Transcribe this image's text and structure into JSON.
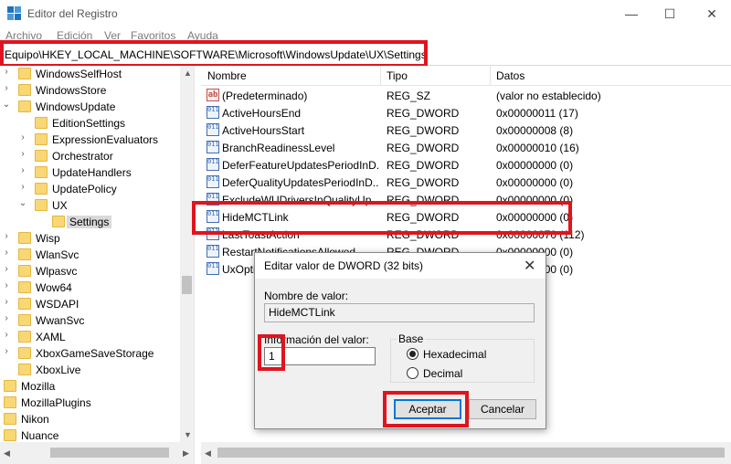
{
  "window": {
    "title": "Editor del Registro",
    "minimize": "—",
    "maximize": "☐",
    "close": "✕"
  },
  "menu": [
    "Archivo",
    "Edición",
    "Ver",
    "Favoritos",
    "Ayuda"
  ],
  "address": "Equipo\\HKEY_LOCAL_MACHINE\\SOFTWARE\\Microsoft\\WindowsUpdate\\UX\\Settings",
  "tree": [
    {
      "label": "WindowsSelfHost",
      "level": 1,
      "arrow": "›"
    },
    {
      "label": "WindowsStore",
      "level": 1,
      "arrow": "›"
    },
    {
      "label": "WindowsUpdate",
      "level": 1,
      "arrow": "⌄"
    },
    {
      "label": "EditionSettings",
      "level": 2,
      "arrow": ""
    },
    {
      "label": "ExpressionEvaluators",
      "level": 2,
      "arrow": "›"
    },
    {
      "label": "Orchestrator",
      "level": 2,
      "arrow": "›"
    },
    {
      "label": "UpdateHandlers",
      "level": 2,
      "arrow": "›"
    },
    {
      "label": "UpdatePolicy",
      "level": 2,
      "arrow": "›"
    },
    {
      "label": "UX",
      "level": 2,
      "arrow": "⌄"
    },
    {
      "label": "Settings",
      "level": 3,
      "arrow": "",
      "selected": true
    },
    {
      "label": "Wisp",
      "level": 1,
      "arrow": "›"
    },
    {
      "label": "WlanSvc",
      "level": 1,
      "arrow": "›"
    },
    {
      "label": "Wlpasvc",
      "level": 1,
      "arrow": "›"
    },
    {
      "label": "Wow64",
      "level": 1,
      "arrow": "›"
    },
    {
      "label": "WSDAPI",
      "level": 1,
      "arrow": "›"
    },
    {
      "label": "WwanSvc",
      "level": 1,
      "arrow": "›"
    },
    {
      "label": "XAML",
      "level": 1,
      "arrow": "›"
    },
    {
      "label": "XboxGameSaveStorage",
      "level": 1,
      "arrow": "›"
    },
    {
      "label": "XboxLive",
      "level": 1,
      "arrow": ""
    },
    {
      "label": "Mozilla",
      "level": 0,
      "arrow": ""
    },
    {
      "label": "MozillaPlugins",
      "level": 0,
      "arrow": ""
    },
    {
      "label": "Nikon",
      "level": 0,
      "arrow": ""
    },
    {
      "label": "Nuance",
      "level": 0,
      "arrow": ""
    }
  ],
  "columns": [
    "Nombre",
    "Tipo",
    "Datos"
  ],
  "values": [
    {
      "name": "(Predeterminado)",
      "type": "REG_SZ",
      "data": "(valor no establecido)",
      "icon": "ab"
    },
    {
      "name": "ActiveHoursEnd",
      "type": "REG_DWORD",
      "data": "0x00000011 (17)",
      "icon": "bin"
    },
    {
      "name": "ActiveHoursStart",
      "type": "REG_DWORD",
      "data": "0x00000008 (8)",
      "icon": "bin"
    },
    {
      "name": "BranchReadinessLevel",
      "type": "REG_DWORD",
      "data": "0x00000010 (16)",
      "icon": "bin"
    },
    {
      "name": "DeferFeatureUpdatesPeriodInD...",
      "type": "REG_DWORD",
      "data": "0x00000000 (0)",
      "icon": "bin"
    },
    {
      "name": "DeferQualityUpdatesPeriodInD...",
      "type": "REG_DWORD",
      "data": "0x00000000 (0)",
      "icon": "bin"
    },
    {
      "name": "ExcludeWUDriversInQualityUp...",
      "type": "REG_DWORD",
      "data": "0x00000000 (0)",
      "icon": "bin"
    },
    {
      "name": "HideMCTLink",
      "type": "REG_DWORD",
      "data": "0x00000000 (0)",
      "icon": "bin"
    },
    {
      "name": "LastToastAction",
      "type": "REG_DWORD",
      "data": "0x00000070 (112)",
      "icon": "bin"
    },
    {
      "name": "RestartNotificationsAllowed",
      "type": "REG_DWORD",
      "data": "0x00000000 (0)",
      "icon": "bin"
    },
    {
      "name": "UxOption",
      "type": "REG_DWORD",
      "data": "0x00000000 (0)",
      "icon": "bin"
    }
  ],
  "dialog": {
    "title": "Editar valor de DWORD (32 bits)",
    "close": "✕",
    "name_label": "Nombre de valor:",
    "name_value": "HideMCTLink",
    "data_label": "Información del valor:",
    "data_value": "1",
    "base_label": "Base",
    "hex_label": "Hexadecimal",
    "dec_label": "Decimal",
    "ok_label": "Aceptar",
    "cancel_label": "Cancelar"
  },
  "colors": {
    "highlight": "#e0141e",
    "folder": "#f8d775",
    "accent": "#0078d7"
  }
}
